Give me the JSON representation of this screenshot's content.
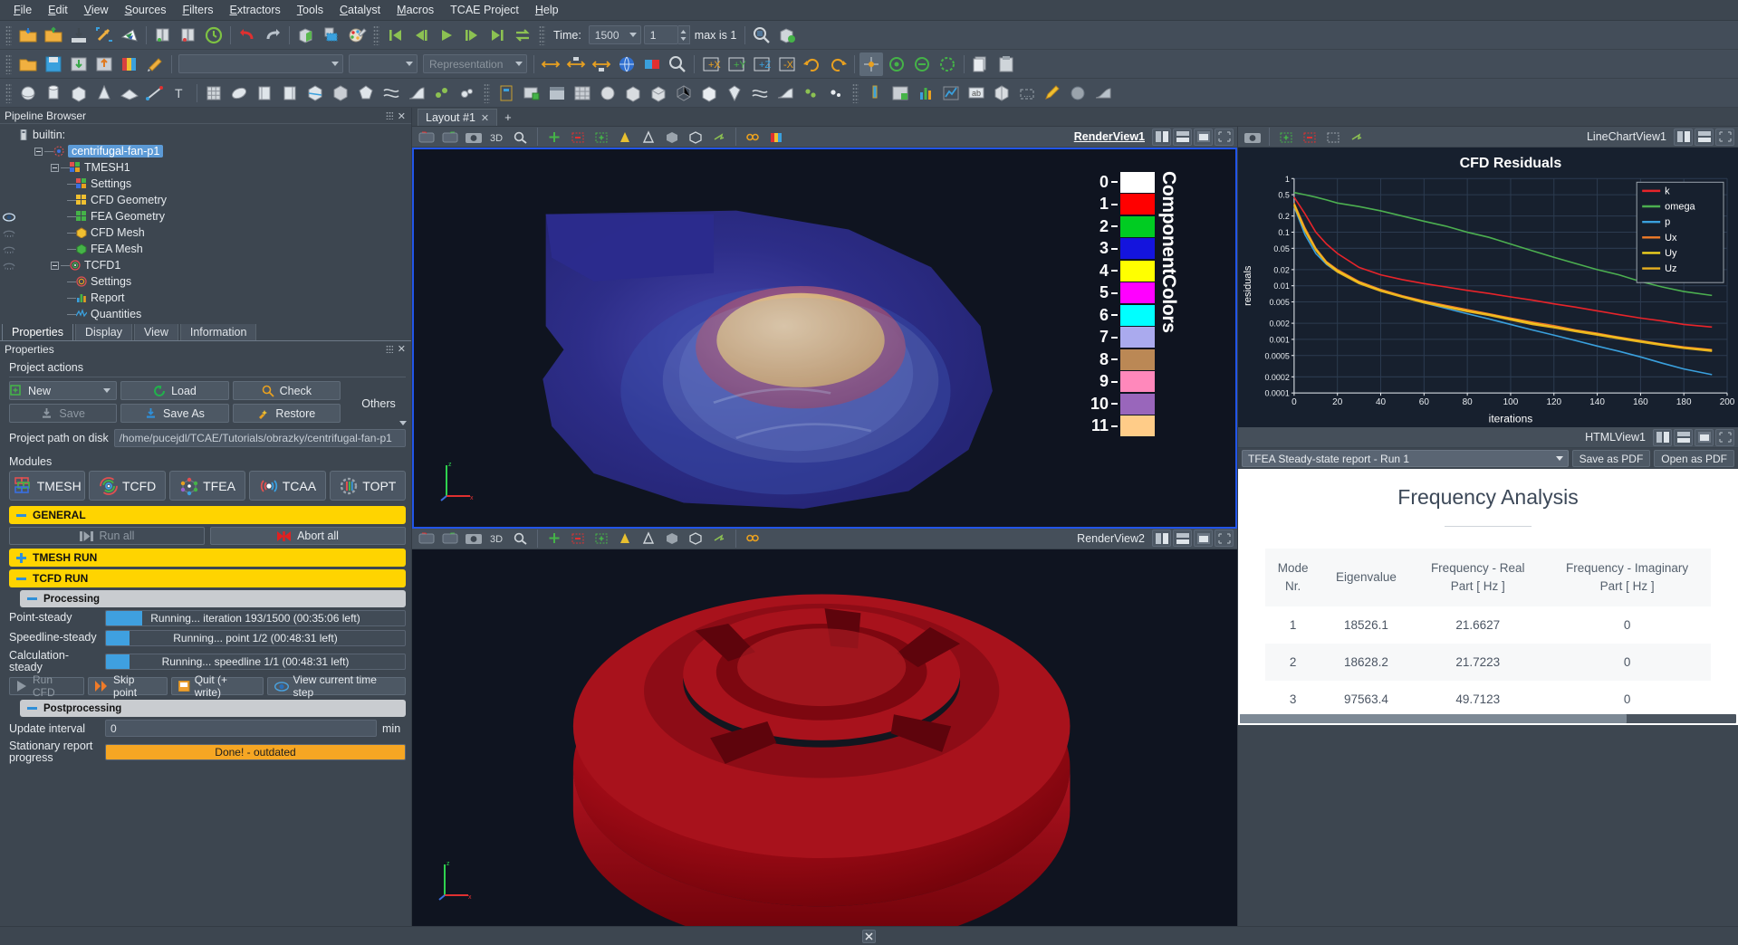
{
  "menubar": {
    "items": [
      "File",
      "Edit",
      "View",
      "Sources",
      "Filters",
      "Extractors",
      "Tools",
      "Catalyst",
      "Macros",
      "TCAE Project",
      "Help"
    ]
  },
  "toolbar": {
    "time_label": "Time:",
    "time_value": "1500",
    "frame_value": "1",
    "max_label": "max is 1",
    "representation_placeholder": "Representation",
    "array_placeholder": "",
    "solid_placeholder": ""
  },
  "pipeline": {
    "title": "Pipeline Browser",
    "items": [
      {
        "label": "builtin:",
        "depth": 0,
        "icon": "server-icon",
        "selected": false,
        "eye": "none"
      },
      {
        "label": "centrifugal-fan-p1",
        "depth": 1,
        "icon": "project-icon",
        "selected": true,
        "eye": "none"
      },
      {
        "label": "TMESH1",
        "depth": 2,
        "icon": "tmesh-icon",
        "selected": false,
        "eye": "none"
      },
      {
        "label": "Settings",
        "depth": 3,
        "icon": "settings-icon",
        "selected": false,
        "eye": "none"
      },
      {
        "label": "CFD Geometry",
        "depth": 3,
        "icon": "geometry-yellow-icon",
        "selected": false,
        "eye": "visible"
      },
      {
        "label": "FEA Geometry",
        "depth": 3,
        "icon": "geometry-green-icon",
        "selected": false,
        "eye": "hidden"
      },
      {
        "label": "CFD Mesh",
        "depth": 3,
        "icon": "mesh-yellow-icon",
        "selected": false,
        "eye": "hidden"
      },
      {
        "label": "FEA Mesh",
        "depth": 3,
        "icon": "mesh-green-icon",
        "selected": false,
        "eye": "hidden"
      },
      {
        "label": "TCFD1",
        "depth": 2,
        "icon": "tcfd-icon",
        "selected": false,
        "eye": "none"
      },
      {
        "label": "Settings",
        "depth": 3,
        "icon": "tcfd-settings-icon",
        "selected": false,
        "eye": "none"
      },
      {
        "label": "Report",
        "depth": 3,
        "icon": "report-icon",
        "selected": false,
        "eye": "none"
      },
      {
        "label": "Quantities",
        "depth": 3,
        "icon": "quantities-icon",
        "selected": false,
        "eye": "none"
      }
    ]
  },
  "properties": {
    "tabs": [
      "Properties",
      "Display",
      "View",
      "Information"
    ],
    "active_tab": "Properties",
    "panel_title": "Properties",
    "project_actions_label": "Project actions",
    "buttons": {
      "new": "New",
      "load": "Load",
      "check": "Check",
      "save": "Save",
      "save_as": "Save As",
      "restore": "Restore",
      "others": "Others"
    },
    "path_label": "Project path on disk",
    "path_value": "/home/pucejdl/TCAE/Tutorials/obrazky/centrifugal-fan-p1",
    "modules_label": "Modules",
    "modules": [
      "TMESH",
      "TCFD",
      "TFEA",
      "TCAA",
      "TOPT"
    ],
    "sections": {
      "general": "GENERAL",
      "tmesh_run": "TMESH RUN",
      "tcfd_run": "TCFD RUN",
      "processing": "Processing",
      "postprocessing": "Postprocessing"
    },
    "run_all": "Run all",
    "abort_all": "Abort all",
    "progress": [
      {
        "name": "Point-steady",
        "text": "Running... iteration 193/1500 (00:35:06 left)",
        "fill": 12,
        "color": "blue"
      },
      {
        "name": "Speedline-steady",
        "text": "Running... point 1/2 (00:48:31 left)",
        "fill": 8,
        "color": "blue"
      },
      {
        "name": "Calculation-steady",
        "text": "Running... speedline 1/1 (00:48:31 left)",
        "fill": 8,
        "color": "blue"
      }
    ],
    "actions": [
      {
        "label": "Run CFD",
        "icon": "play-icon",
        "dim": true
      },
      {
        "label": "Skip point",
        "icon": "skip-icon",
        "dim": false
      },
      {
        "label": "Quit (+ write)",
        "icon": "quit-icon",
        "dim": false
      },
      {
        "label": "View current time step",
        "icon": "eye-icon",
        "dim": false
      }
    ],
    "update_interval_label": "Update interval",
    "update_interval_value": "0",
    "update_interval_unit": "min",
    "stationary_label": "Stationary report progress",
    "stationary_status": "Done! - outdated"
  },
  "layout": {
    "tab_label": "Layout #1",
    "plus": "+"
  },
  "views": {
    "render1": {
      "name": "RenderView1",
      "active": true,
      "legend_title": "ComponentColors",
      "legend_entries": [
        {
          "label": "0",
          "color": "#ffffff"
        },
        {
          "label": "1",
          "color": "#ff0000"
        },
        {
          "label": "2",
          "color": "#00cc22"
        },
        {
          "label": "3",
          "color": "#1414dd"
        },
        {
          "label": "4",
          "color": "#ffff00"
        },
        {
          "label": "5",
          "color": "#ff00ff"
        },
        {
          "label": "6",
          "color": "#00ffff"
        },
        {
          "label": "7",
          "color": "#aaaaee"
        },
        {
          "label": "8",
          "color": "#bb8855"
        },
        {
          "label": "9",
          "color": "#ff88bb"
        },
        {
          "label": "10",
          "color": "#9966bb"
        },
        {
          "label": "11",
          "color": "#ffcc88"
        }
      ]
    },
    "render2": {
      "name": "RenderView2",
      "active": false
    },
    "linechart": {
      "name": "LineChartView1"
    },
    "htmlview": {
      "name": "HTMLView1"
    }
  },
  "chart_data": {
    "type": "line",
    "title": "CFD Residuals",
    "xlabel": "iterations",
    "ylabel": "residuals",
    "xlim": [
      0,
      200
    ],
    "ylim": [
      0.0001,
      1
    ],
    "yscale": "log",
    "grid": true,
    "legend_position": "top-right",
    "xticks": [
      0,
      20,
      40,
      60,
      80,
      100,
      120,
      140,
      160,
      180,
      200
    ],
    "yticks": [
      "1",
      "0.5",
      "0.2",
      "0.1",
      "0.05",
      "0.02",
      "0.01",
      "0.005",
      "0.002",
      "0.001",
      "0.0005",
      "0.0002",
      "0.0001"
    ],
    "x": [
      0,
      5,
      10,
      15,
      20,
      30,
      40,
      50,
      60,
      70,
      80,
      90,
      100,
      110,
      120,
      130,
      140,
      150,
      160,
      170,
      180,
      193
    ],
    "series": [
      {
        "name": "k",
        "color": "#e8242a",
        "values": [
          0.45,
          0.22,
          0.1,
          0.06,
          0.04,
          0.022,
          0.016,
          0.013,
          0.011,
          0.0095,
          0.0082,
          0.0072,
          0.0062,
          0.0054,
          0.0046,
          0.004,
          0.0034,
          0.0029,
          0.0025,
          0.0022,
          0.0019,
          0.0017
        ]
      },
      {
        "name": "omega",
        "color": "#4caf50",
        "values": [
          0.55,
          0.5,
          0.45,
          0.4,
          0.35,
          0.3,
          0.25,
          0.2,
          0.16,
          0.13,
          0.1,
          0.08,
          0.06,
          0.045,
          0.034,
          0.026,
          0.02,
          0.016,
          0.012,
          0.0095,
          0.0078,
          0.0066
        ]
      },
      {
        "name": "p",
        "color": "#3aa0dd",
        "values": [
          0.3,
          0.09,
          0.04,
          0.025,
          0.018,
          0.012,
          0.0085,
          0.0062,
          0.0048,
          0.0038,
          0.003,
          0.0024,
          0.0019,
          0.0015,
          0.0012,
          0.00095,
          0.00075,
          0.0006,
          0.00047,
          0.00036,
          0.00028,
          0.00022
        ]
      },
      {
        "name": "Ux",
        "color": "#f07b28",
        "values": [
          0.35,
          0.12,
          0.05,
          0.028,
          0.02,
          0.012,
          0.0085,
          0.0065,
          0.0052,
          0.0043,
          0.0036,
          0.003,
          0.0025,
          0.0021,
          0.0018,
          0.0015,
          0.0013,
          0.0011,
          0.00095,
          0.00082,
          0.00072,
          0.00064
        ]
      },
      {
        "name": "Uy",
        "color": "#f2d21e",
        "values": [
          0.33,
          0.11,
          0.048,
          0.027,
          0.019,
          0.0115,
          0.0082,
          0.0063,
          0.005,
          0.0041,
          0.0034,
          0.0029,
          0.0024,
          0.002,
          0.0017,
          0.00145,
          0.00125,
          0.00107,
          0.00092,
          0.0008,
          0.0007,
          0.00062
        ]
      },
      {
        "name": "Uz",
        "color": "#e8b020",
        "values": [
          0.31,
          0.105,
          0.046,
          0.026,
          0.018,
          0.011,
          0.0079,
          0.0061,
          0.0048,
          0.004,
          0.0033,
          0.0028,
          0.0023,
          0.0019,
          0.00165,
          0.0014,
          0.0012,
          0.00103,
          0.00089,
          0.00077,
          0.00068,
          0.0006
        ]
      }
    ]
  },
  "report": {
    "selector_value": "TFEA Steady-state report - Run 1",
    "save_pdf": "Save as PDF",
    "open_pdf": "Open as PDF",
    "title": "Frequency Analysis",
    "columns": [
      "Mode Nr.",
      "Eigenvalue",
      "Frequency - Real Part [ Hz ]",
      "Frequency - Imaginary Part [ Hz ]"
    ],
    "rows": [
      [
        "1",
        "18526.1",
        "21.6627",
        "0"
      ],
      [
        "2",
        "18628.2",
        "21.7223",
        "0"
      ],
      [
        "3",
        "97563.4",
        "49.7123",
        "0"
      ]
    ]
  }
}
